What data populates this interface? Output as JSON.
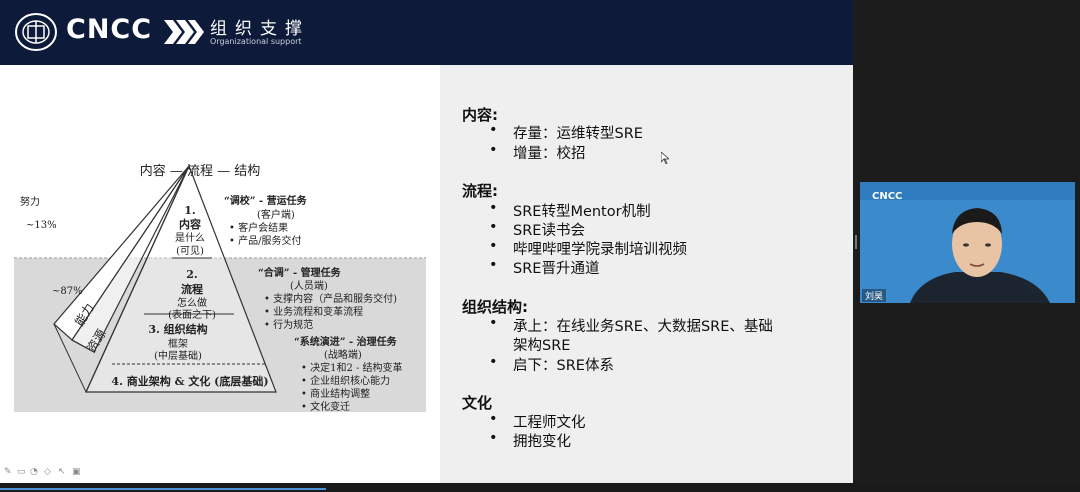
{
  "header": {
    "logo_text": "CNCC",
    "section_title": "组织支撑",
    "section_subtitle": "Organizational support"
  },
  "diagram": {
    "top_title": "内容 — 流程 — 结构",
    "effort_label": "努力",
    "pct_13": "~13%",
    "pct_87": "~87%",
    "ability": "能力",
    "resource": "资源",
    "level1": {
      "num": "1.",
      "title": "内容",
      "line2": "是什么",
      "line3": "(可见)"
    },
    "level2": {
      "title": "2.",
      "line1": "流程",
      "line2": "怎么做",
      "line3": "(表面之下)"
    },
    "level3": {
      "title": "3. 组织结构",
      "line2": "框架",
      "line3": "(中层基础)"
    },
    "level4": {
      "title": "4. 商业架构 & 文化 (底层基础)"
    },
    "task1": {
      "title": "“调校” - 营运任务",
      "sub": "(客户端)",
      "items": [
        "• 客户会结果",
        "• 产品/服务交付"
      ]
    },
    "task2": {
      "title": "“合调” - 管理任务",
      "sub": "(人员端)",
      "items": [
        "• 支撑内容（产品和服务交付)",
        "• 业务流程和变革流程",
        "• 行为规范"
      ]
    },
    "task3": {
      "title": "“系统演进” - 治理任务",
      "sub": "(战略端)",
      "items": [
        "• 决定1和2 - 结构变革",
        "• 企业组织核心能力",
        "• 商业结构调整",
        "• 文化变迁"
      ]
    }
  },
  "content": {
    "sections": [
      {
        "heading": "内容:",
        "bullets": [
          "存量：运维转型SRE",
          "增量：校招"
        ]
      },
      {
        "heading": "流程:",
        "bullets": [
          "SRE转型Mentor机制",
          "SRE读书会",
          "哔哩哔哩学院录制培训视频",
          "SRE晋升通道"
        ]
      },
      {
        "heading": "组织结构:",
        "bullets": [
          "承上：在线业务SRE、大数据SRE、基础",
          "启下：SRE体系"
        ],
        "continuation": "架构SRE"
      },
      {
        "heading": "文化",
        "bullets": [
          "工程师文化",
          "拥抱变化"
        ]
      }
    ]
  },
  "video": {
    "logo": "CNCC",
    "participant": "刘昊"
  },
  "colors": {
    "header_bg": "#0d1a3a",
    "right_panel": "#efefef",
    "video_bg": "#3e8fcf",
    "progress": "#4a90d9"
  },
  "icons": [
    "pen-icon",
    "eraser-icon",
    "highlighter-icon",
    "shape-icon",
    "pointer-icon",
    "camera-icon"
  ]
}
